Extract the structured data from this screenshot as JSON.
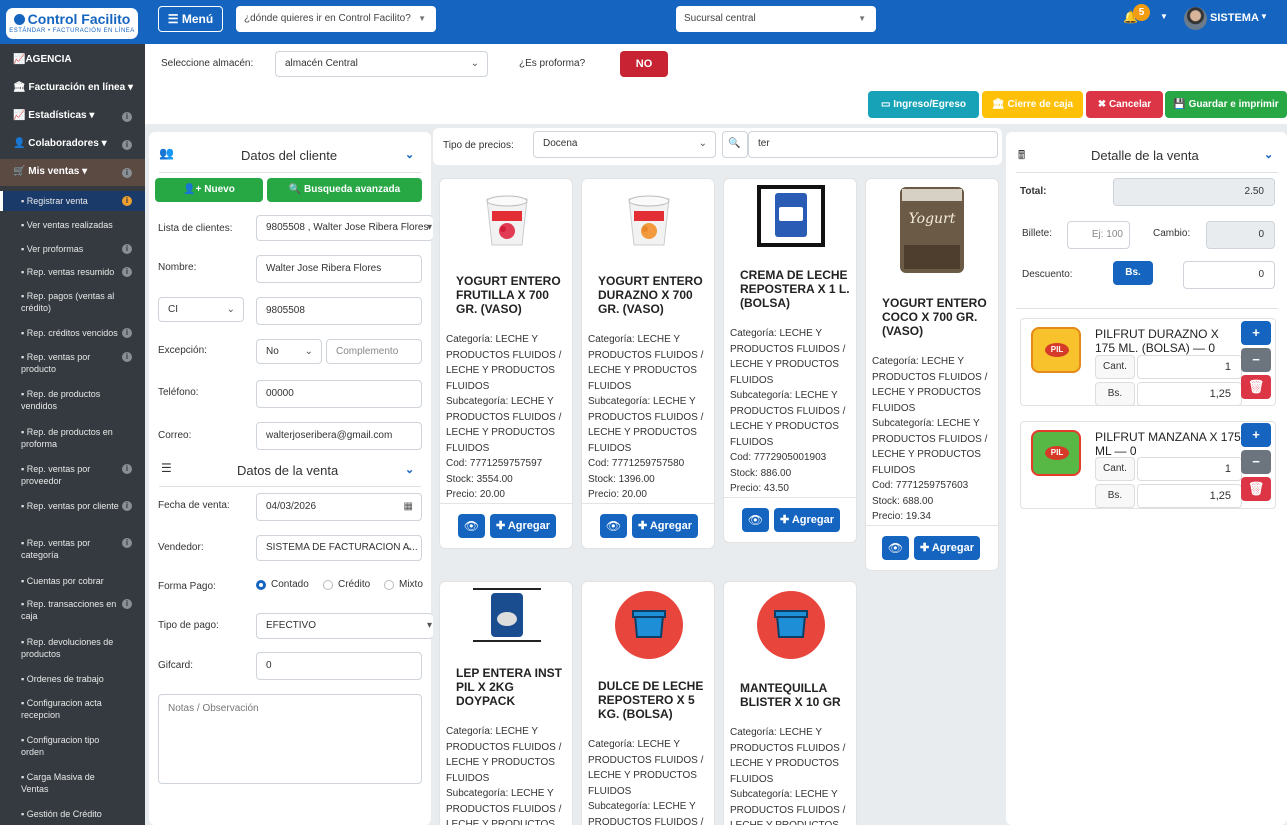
{
  "brand": {
    "name": "Control Facilito",
    "tagline": "ESTÁNDAR • FACTURACIÓN EN LÍNEA"
  },
  "topbar": {
    "menu_label": "Menú",
    "search_placeholder": "¿dónde quieres ir en Control Facilito?",
    "branch": "Sucursal central",
    "notif_count": "5",
    "user": "SISTEMA"
  },
  "sidebar": {
    "sections": [
      {
        "label": "AGENCIA",
        "caret": "▾"
      },
      {
        "label": "Facturación en línea",
        "caret": "▾"
      },
      {
        "label": "Estadísticas",
        "caret": "▾"
      },
      {
        "label": "Colaboradores",
        "caret": "▾"
      },
      {
        "label": "Mis ventas",
        "caret": "▾"
      }
    ],
    "items": [
      "Registrar venta",
      "Ver ventas realizadas",
      "Ver proformas",
      "Rep. ventas resumido",
      "Rep. pagos (ventas al crédito)",
      "Rep. créditos vencidos",
      "Rep. ventas por producto",
      "Rep. de productos vendidos",
      "Rep. de productos en proforma",
      "Rep. ventas por proveedor",
      "Rep. ventas por cliente",
      "Rep. ventas por categoría",
      "Cuentas por cobrar",
      "Rep. transacciones en caja",
      "Rep. devoluciones de productos",
      "Ordenes de trabajo",
      "Configuracion acta recepcion",
      "Configuracion tipo orden",
      "Carga Masiva de Ventas",
      "Gestión de Crédito"
    ]
  },
  "controls": {
    "warehouse_label": "Seleccione almacén:",
    "warehouse": "almacén Central",
    "proforma_label": "¿Es proforma?",
    "proforma_value": "NO"
  },
  "actions": {
    "income": "Ingreso/Egreso",
    "close_cash": "Cierre de caja",
    "cancel": "Cancelar",
    "save_print": "Guardar e imprimir"
  },
  "client": {
    "title": "Datos del cliente",
    "new": "Nuevo",
    "advanced": "Busqueda avanzada",
    "list_label": "Lista de clientes:",
    "list_value": "9805508 , Walter Jose Ribera Flores",
    "name_label": "Nombre:",
    "name_value": "Walter Jose Ribera Flores",
    "doc_type": "CI",
    "doc_value": "9805508",
    "exception_label": "Excepción:",
    "exception_value": "No",
    "complement_placeholder": "Complemento",
    "phone_label": "Teléfono:",
    "phone_value": "00000",
    "email_label": "Correo:",
    "email_value": "walterjoseribera@gmail.com"
  },
  "sale": {
    "title": "Datos de la venta",
    "date_label": "Fecha de venta:",
    "date_value": "04/03/2026",
    "seller_label": "Vendedor:",
    "seller_value": "SISTEMA DE FACTURACION A...",
    "payment_form_label": "Forma Pago:",
    "payment_options": [
      "Contado",
      "Crédito",
      "Mixto"
    ],
    "payment_type_label": "Tipo de pago:",
    "payment_type_value": "EFECTIVO",
    "giftcard_label": "Gifcard:",
    "giftcard_value": "0",
    "notes_placeholder": "Notas / Observación"
  },
  "catalog": {
    "price_type_label": "Tipo de precios:",
    "price_type": "Docena",
    "search_value": "ter",
    "add_label": "Agregar",
    "products": [
      {
        "title": "YOGURT ENTERO FRUTILLA X 700 GR. (VASO)",
        "category": "Categoría: LECHE Y PRODUCTOS FLUIDOS / LECHE Y PRODUCTOS FLUIDOS",
        "subcategory": "Subcategoría: LECHE Y PRODUCTOS FLUIDOS / LECHE Y PRODUCTOS FLUIDOS",
        "code": "Cod: 7771259757597",
        "stock": "Stock: 3554.00",
        "price": "Precio: 20.00"
      },
      {
        "title": "YOGURT ENTERO DURAZNO X 700 GR. (VASO)",
        "category": "Categoría: LECHE Y PRODUCTOS FLUIDOS / LECHE Y PRODUCTOS FLUIDOS",
        "subcategory": "Subcategoría: LECHE Y PRODUCTOS FLUIDOS / LECHE Y PRODUCTOS FLUIDOS",
        "code": "Cod: 7771259757580",
        "stock": "Stock: 1396.00",
        "price": "Precio: 20.00"
      },
      {
        "title": "CREMA DE LECHE REPOSTERA X 1 L. (BOLSA)",
        "category": "Categoría: LECHE Y PRODUCTOS FLUIDOS / LECHE Y PRODUCTOS FLUIDOS",
        "subcategory": "Subcategoría: LECHE Y PRODUCTOS FLUIDOS / LECHE Y PRODUCTOS FLUIDOS",
        "code": "Cod: 7772905001903",
        "stock": "Stock: 886.00",
        "price": "Precio: 43.50"
      },
      {
        "title": "YOGURT ENTERO COCO X 700 GR. (VASO)",
        "category": "Categoría: LECHE Y PRODUCTOS FLUIDOS / LECHE Y PRODUCTOS FLUIDOS",
        "subcategory": "Subcategoría: LECHE Y PRODUCTOS FLUIDOS / LECHE Y PRODUCTOS FLUIDOS",
        "code": "Cod: 7771259757603",
        "stock": "Stock: 688.00",
        "price": "Precio: 19.34"
      },
      {
        "title": "LEP ENTERA INST PIL X 2KG DOYPACK",
        "category": "Categoría: LECHE Y PRODUCTOS FLUIDOS / LECHE Y PRODUCTOS FLUIDOS",
        "subcategory": "Subcategoría: LECHE Y PRODUCTOS FLUIDOS / LECHE Y PRODUCTOS"
      },
      {
        "title": "DULCE DE LECHE REPOSTERO X 5 KG. (BOLSA)",
        "category": "Categoría: LECHE Y PRODUCTOS FLUIDOS / LECHE Y PRODUCTOS FLUIDOS",
        "subcategory": "Subcategoría: LECHE Y PRODUCTOS FLUIDOS / LECHE Y PRODUCTOS"
      },
      {
        "title": "MANTEQUILLA BLISTER X 10 GR",
        "category": "Categoría: LECHE Y PRODUCTOS FLUIDOS / LECHE Y PRODUCTOS FLUIDOS",
        "subcategory": "Subcategoría: LECHE Y PRODUCTOS FLUIDOS / LECHE Y PRODUCTOS"
      }
    ]
  },
  "detail": {
    "title": "Detalle de la venta",
    "total_label": "Total:",
    "total": "2.50",
    "bill_label": "Billete:",
    "bill_placeholder": "Ej: 100",
    "change_label": "Cambio:",
    "change": "0",
    "discount_label": "Descuento:",
    "discount_unit": "Bs.",
    "discount": "0",
    "qty_label": "Cant.",
    "bs_label": "Bs.",
    "items": [
      {
        "name": "PILFRUT DURAZNO X 175 ML. (BOLSA) — 0",
        "qty": "1",
        "amount": "1,25"
      },
      {
        "name": "PILFRUT MANZANA X 175 ML — 0",
        "qty": "1",
        "amount": "1,25"
      }
    ]
  },
  "colors": {
    "primary": "#1565c0",
    "success": "#28a745",
    "danger": "#dc3545",
    "warning": "#ffc107",
    "info": "#17a2b8",
    "sidebar": "#343a40"
  }
}
